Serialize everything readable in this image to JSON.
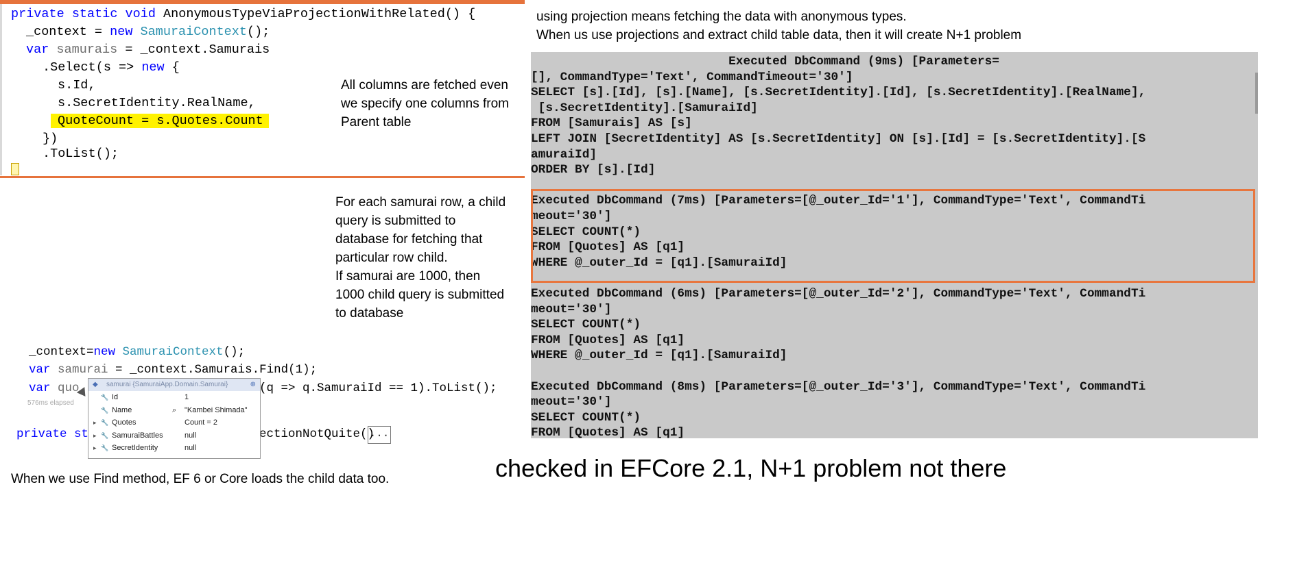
{
  "code_top": {
    "line1_a": "private static void ",
    "line1_b": "AnonymousTypeViaProjectionWithRelated() {",
    "line2_a": "_context = ",
    "line2_kw": "new ",
    "line2_ty": "SamuraiContext",
    "line2_b": "();",
    "line3_kw": "var ",
    "line3_gr": "samurais",
    "line3_b": " = _context.Samurais",
    "line4_a": ".Select(s => ",
    "line4_kw": "new",
    "line4_b": " {",
    "line5": "s.Id,",
    "line6": "s.SecretIdentity.RealName,",
    "line7": "QuoteCount = s.Quotes.Count",
    "line8": "})",
    "line9": ".ToList();"
  },
  "notes": {
    "projection_line1": "using projection means fetching the data with anonymous types.",
    "projection_line2": "When us use projections and extract child table data, then it will create N+1 problem",
    "all_columns_1": "All columns are fetched even",
    "all_columns_2": "we specify one columns from",
    "all_columns_3": "Parent table",
    "child_1": "For each samurai row, a child",
    "child_2": "query is submitted to",
    "child_3": "database for fetching that",
    "child_4": "particular row child.",
    "child_5": "If samurai are 1000, then",
    "child_6": "1000 child query is submitted",
    "child_7": "to database",
    "find_note": "When we use Find method, EF 6 or Core loads the child data too.",
    "efcore_note": "checked in EFCore 2.1, N+1 problem not there"
  },
  "console": {
    "lines": [
      "                           Executed DbCommand (9ms) [Parameters=",
      "[], CommandType='Text', CommandTimeout='30']",
      "SELECT [s].[Id], [s].[Name], [s.SecretIdentity].[Id], [s.SecretIdentity].[RealName],",
      " [s.SecretIdentity].[SamuraiId]",
      "FROM [Samurais] AS [s]",
      "LEFT JOIN [SecretIdentity] AS [s.SecretIdentity] ON [s].[Id] = [s.SecretIdentity].[S",
      "amuraiId]",
      "ORDER BY [s].[Id]",
      "",
      "Executed DbCommand (7ms) [Parameters=[@_outer_Id='1'], CommandType='Text', CommandTi",
      "meout='30']",
      "SELECT COUNT(*)",
      "FROM [Quotes] AS [q1]",
      "WHERE @_outer_Id = [q1].[SamuraiId]",
      "",
      "Executed DbCommand (6ms) [Parameters=[@_outer_Id='2'], CommandType='Text', CommandTi",
      "meout='30']",
      "SELECT COUNT(*)",
      "FROM [Quotes] AS [q1]",
      "WHERE @_outer_Id = [q1].[SamuraiId]",
      "",
      "Executed DbCommand (8ms) [Parameters=[@_outer_Id='3'], CommandType='Text', CommandTi",
      "meout='30']",
      "SELECT COUNT(*)",
      "FROM [Quotes] AS [q1]"
    ]
  },
  "snippet": {
    "l1_a": "_context=",
    "l1_kw": "new ",
    "l1_ty": "SamuraiContext",
    "l1_b": "();",
    "l2_kw": "var ",
    "l2_gr": "samurai",
    "l2_b": " = _context.Samurais.Find(1);",
    "l3_kw": "var ",
    "l3_gr": "quo",
    "l3_b": "(q => q.SamuraiId == 1).ToList();",
    "l4_kw": "private sta",
    "l4_b": "ectionNotQuite()",
    "dots": "...",
    "elapsed": "576ms elapsed"
  },
  "tooltip": {
    "header": "samurai {SamuraiApp.Domain.Samurai}",
    "rows": [
      {
        "name": "Id",
        "value": "1"
      },
      {
        "name": "Name",
        "value": "\"Kambei Shimada\""
      },
      {
        "name": "Quotes",
        "value": "Count = 2"
      },
      {
        "name": "SamuraiBattles",
        "value": "null"
      },
      {
        "name": "SecretIdentity",
        "value": "null"
      }
    ]
  },
  "colors": {
    "accent_orange": "#e6733c",
    "highlight_yellow": "#fff200",
    "console_bg": "#c9c9c9",
    "keyword_blue": "#0000ff",
    "type_teal": "#2b91af"
  }
}
